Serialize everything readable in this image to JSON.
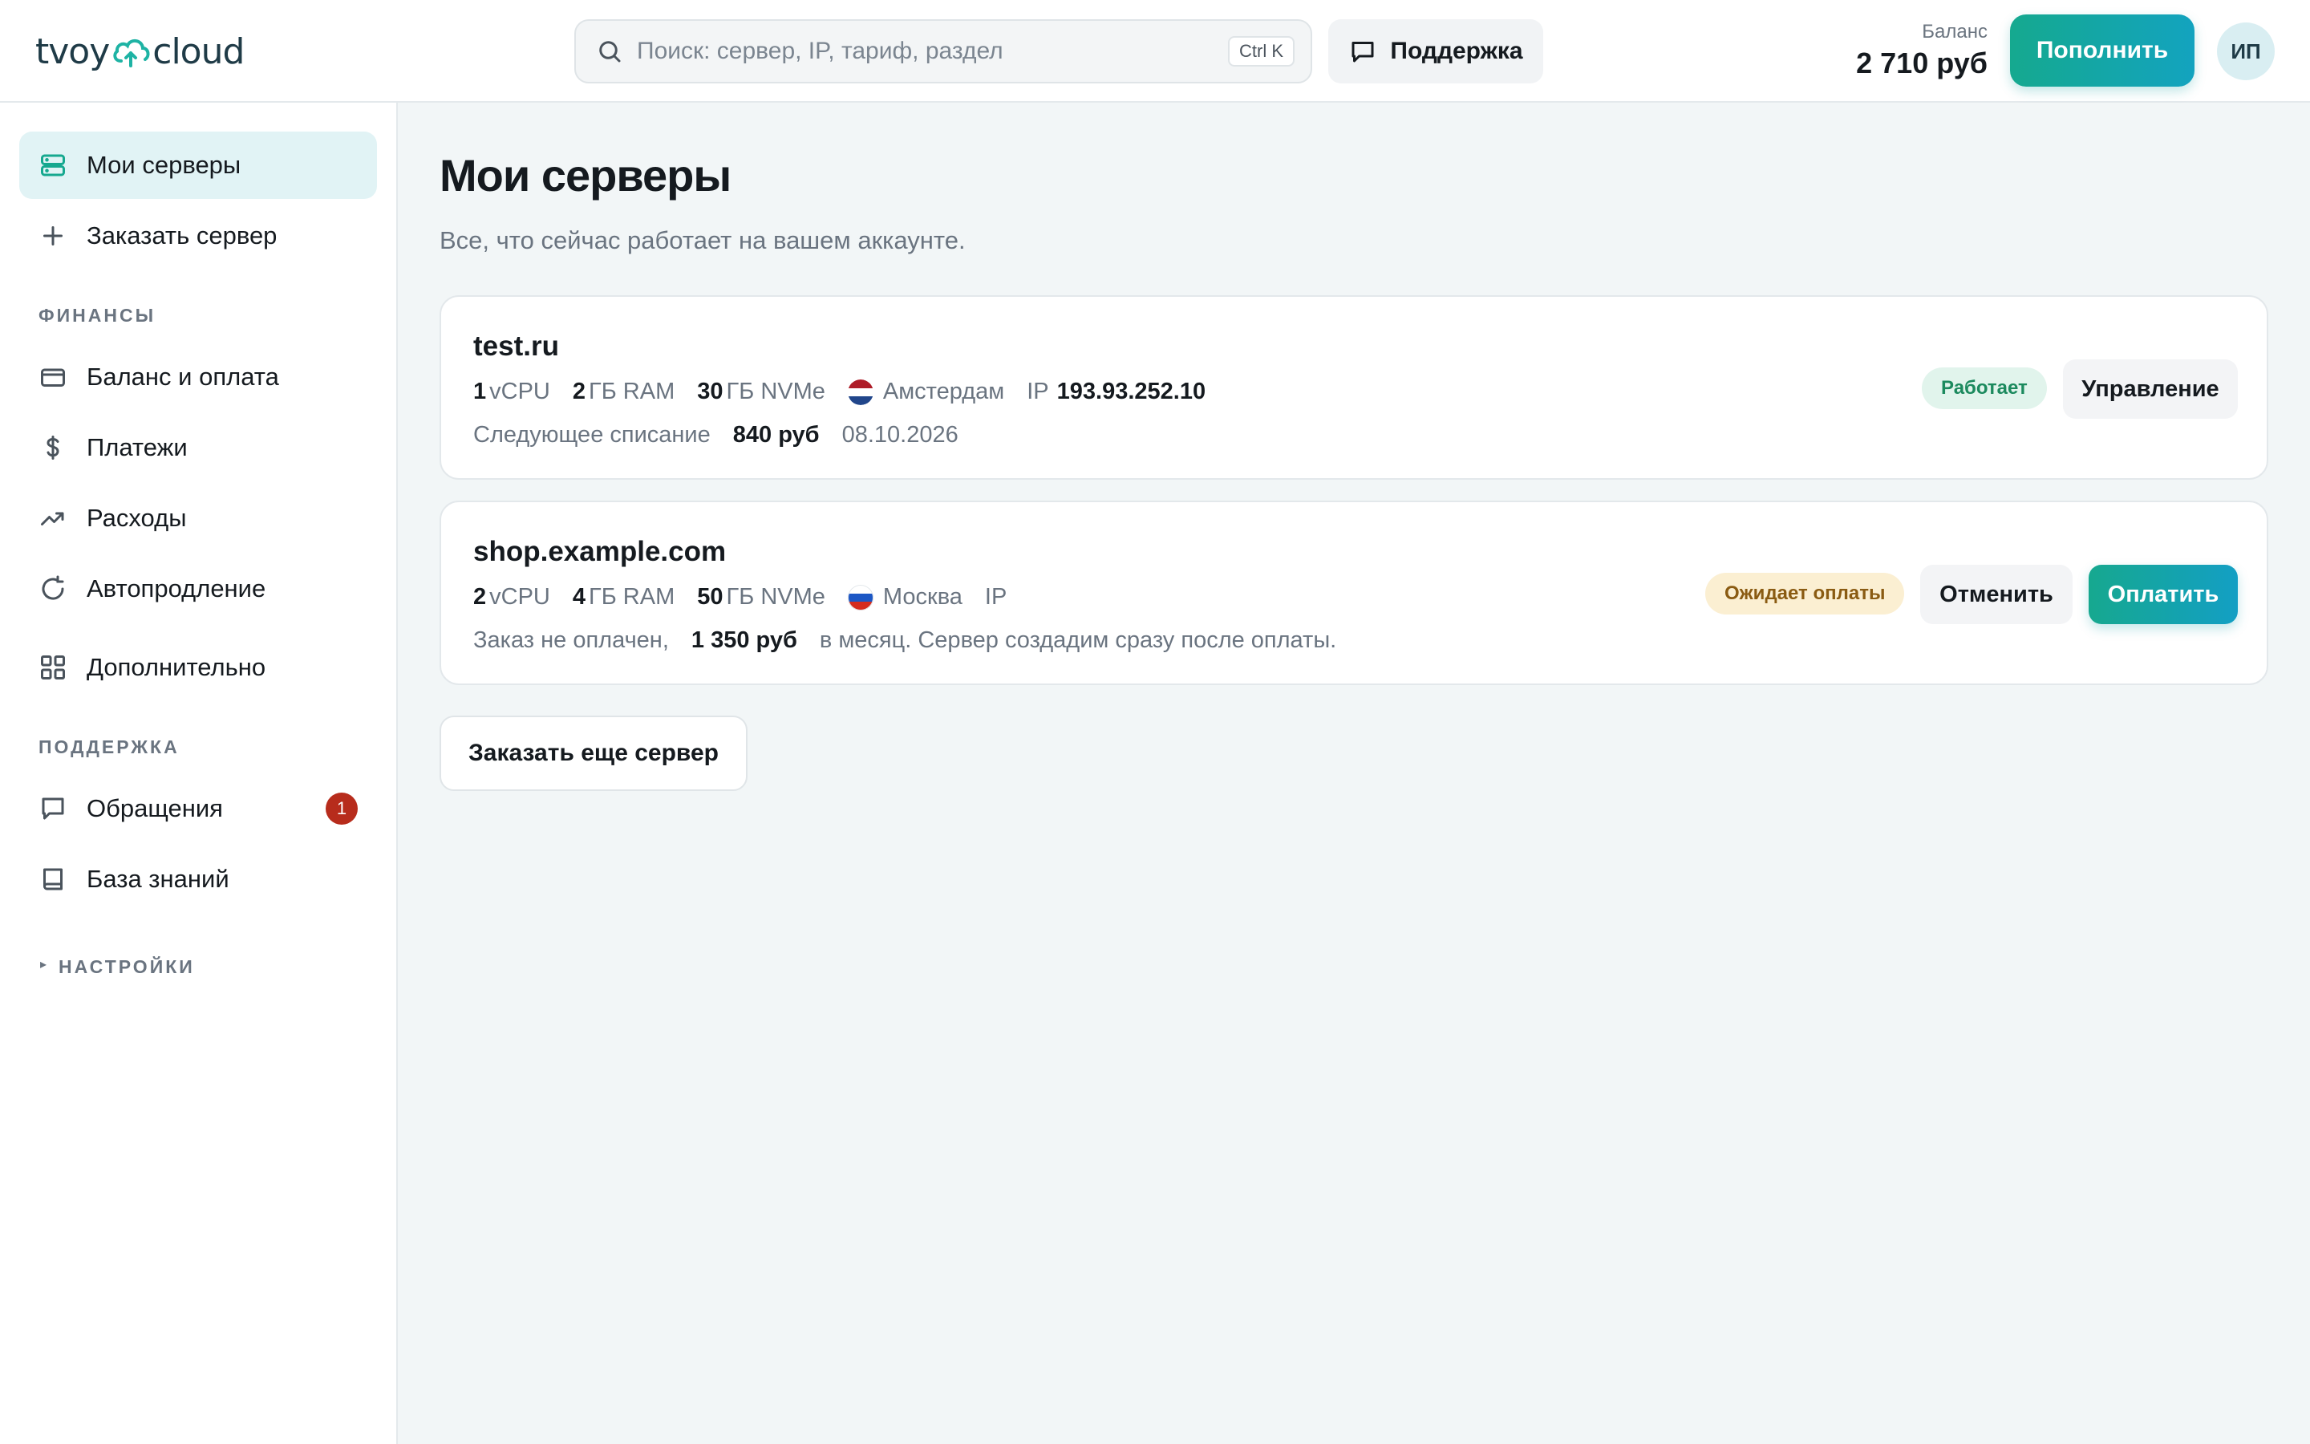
{
  "header": {
    "logo_left": "tvoy",
    "logo_right": "cloud",
    "search_placeholder": "Поиск: сервер, IP, тариф, раздел",
    "search_shortcut": "Ctrl K",
    "support_label": "Поддержка",
    "balance_label": "Баланс",
    "balance_value": "2 710 руб",
    "topup_label": "Пополнить",
    "avatar_initials": "ИП"
  },
  "sidebar": {
    "items_top": [
      {
        "label": "Мои серверы",
        "icon": "server-icon",
        "active": true
      },
      {
        "label": "Заказать сервер",
        "icon": "plus-icon"
      }
    ],
    "finance_label": "ФИНАНСЫ",
    "finance_items": [
      {
        "label": "Баланс и оплата",
        "icon": "credit-card-icon"
      },
      {
        "label": "Платежи",
        "icon": "dollar-icon"
      },
      {
        "label": "Расходы",
        "icon": "trending-up-icon"
      },
      {
        "label": "Автопродление",
        "icon": "refresh-icon"
      },
      {
        "label": "Дополнительно",
        "icon": "grid-icon"
      }
    ],
    "support_label": "ПОДДЕРЖКА",
    "support_items": [
      {
        "label": "Обращения",
        "icon": "message-icon",
        "badge": "1"
      },
      {
        "label": "База знаний",
        "icon": "book-icon"
      }
    ],
    "settings_label": "НАСТРОЙКИ",
    "settings_marker": "▸"
  },
  "main": {
    "title": "Мои серверы",
    "subtitle": "Все, что сейчас работает на вашем аккаунте.",
    "servers": [
      {
        "name": "test.ru",
        "vcpu": "1",
        "vcpu_unit": "vCPU",
        "ram": "2",
        "ram_unit": "ГБ RAM",
        "disk": "30",
        "disk_unit": "ГБ NVMe",
        "location": "Амстердам",
        "ip_label": "IP",
        "ip": "193.93.252.10",
        "billing_label": "Следующее списание",
        "billing_amount": "840 руб",
        "billing_date": "08.10.2026",
        "status": "Работает",
        "action": "Управление"
      },
      {
        "name": "shop.example.com",
        "vcpu": "2",
        "vcpu_unit": "vCPU",
        "ram": "4",
        "ram_unit": "ГБ RAM",
        "disk": "50",
        "disk_unit": "ГБ NVMe",
        "location": "Москва",
        "ip_label": "IP",
        "ip": "",
        "billing_label": "Заказ не оплачен,",
        "billing_amount": "1 350 руб",
        "billing_note": "в месяц. Сервер создадим сразу после оплаты.",
        "status": "Ожидает оплаты",
        "cancel": "Отменить",
        "pay": "Оплатить"
      }
    ],
    "order_more": "Заказать еще сервер"
  },
  "colors": {
    "accent": "#16a88f",
    "accent_2": "#139fc4",
    "active_bg": "#e1f3f5",
    "badge": "#b72c1c"
  }
}
